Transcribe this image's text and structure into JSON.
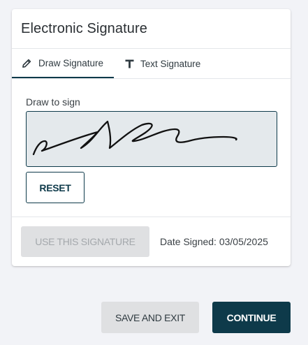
{
  "card": {
    "title": "Electronic Signature"
  },
  "tabs": [
    {
      "label": "Draw Signature",
      "icon": "pencil-icon",
      "active": true
    },
    {
      "label": "Text Signature",
      "icon": "text-t-icon",
      "active": false
    }
  ],
  "draw": {
    "label": "Draw to sign",
    "reset_label": "RESET"
  },
  "footer": {
    "use_signature_label": "USE THIS SIGNATURE",
    "use_signature_enabled": false,
    "date_signed": "Date Signed: 03/05/2025"
  },
  "actions": {
    "save_exit_label": "SAVE AND EXIT",
    "continue_label": "CONTINUE"
  },
  "colors": {
    "accent": "#0e3a4a",
    "page_background": "#f2f3f7",
    "signature_pad": "#e4e9ec",
    "disabled_button": "#dfe0e2"
  }
}
